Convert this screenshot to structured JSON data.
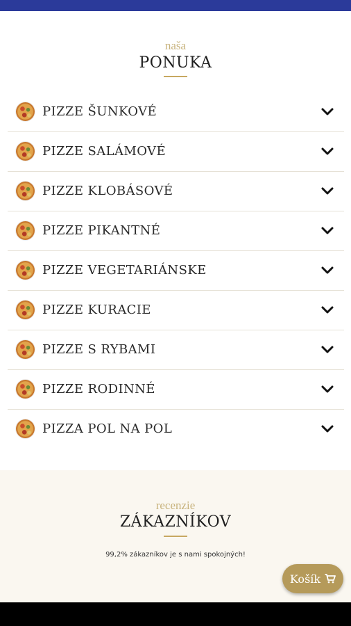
{
  "menu": {
    "kicker": "naša",
    "title": "PONUKA",
    "items": [
      {
        "label": "PIZZE ŠUNKOVÉ"
      },
      {
        "label": "PIZZE SALÁMOVÉ"
      },
      {
        "label": "PIZZE KLOBÁSOVÉ"
      },
      {
        "label": "PIZZE PIKANTNÉ"
      },
      {
        "label": "PIZZE VEGETARIÁNSKE"
      },
      {
        "label": "PIZZE KURACIE"
      },
      {
        "label": "PIZZE S RYBAMI"
      },
      {
        "label": "PIZZE RODINNÉ"
      },
      {
        "label": "PIZZA POL NA POL"
      }
    ],
    "item_icon": "pizza-icon",
    "expand_icon": "chevron-down-icon"
  },
  "reviews": {
    "kicker": "recenzie",
    "title": "ZÁKAZNÍKOV",
    "subtitle": "99,2% zákazníkov je s nami spokojných!"
  },
  "cart": {
    "label": "Košík",
    "icon": "cart-icon"
  },
  "colors": {
    "topbar": "#2b3a9a",
    "accent_gold": "#c7a861",
    "cart_button": "#b59a5a",
    "reviews_bg": "#faf7f0"
  }
}
